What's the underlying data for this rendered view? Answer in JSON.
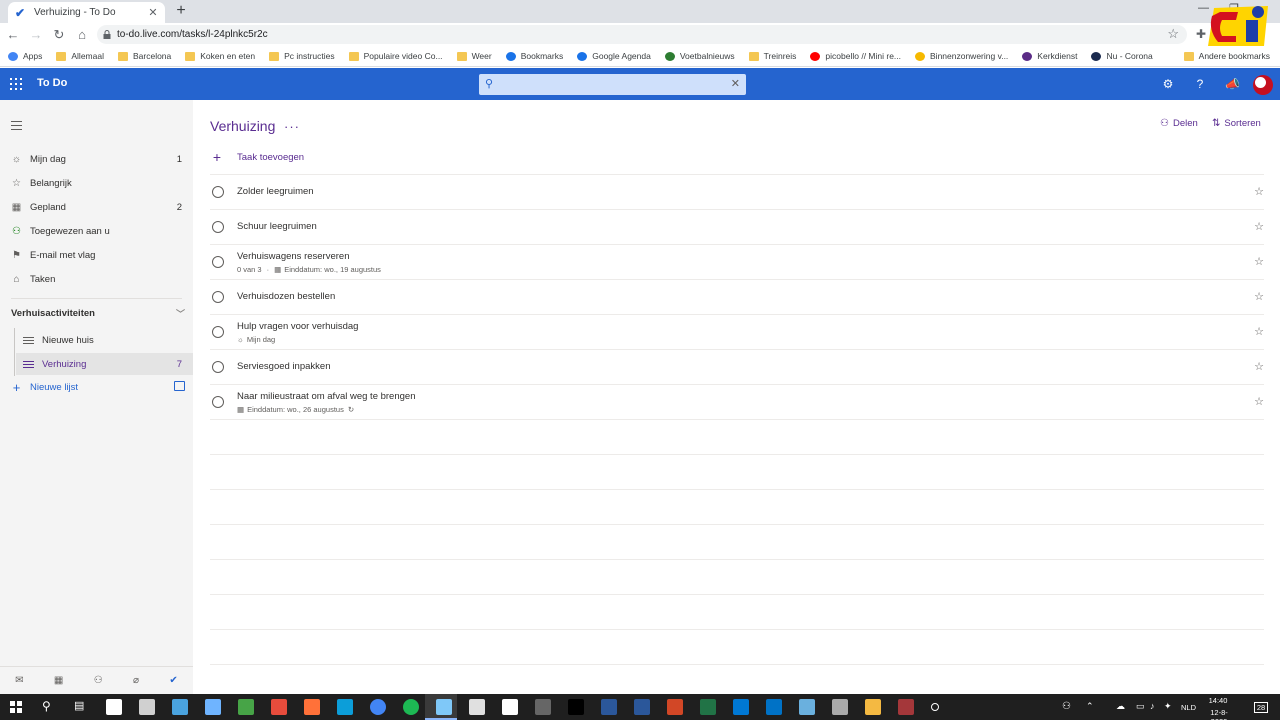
{
  "browser": {
    "tab_title": "Verhuizing - To Do",
    "tab_close": "✕",
    "new_tab": "+",
    "url": "to-do.live.com/tasks/l-24plnkc5r2c",
    "bookmarks": [
      {
        "label": "Apps",
        "icon": "apps-grid-icon",
        "color": "#4285f4"
      },
      {
        "label": "Allemaal",
        "icon": "folder-icon",
        "color": "#f4c753"
      },
      {
        "label": "Barcelona",
        "icon": "folder-icon",
        "color": "#f4c753"
      },
      {
        "label": "Koken en eten",
        "icon": "folder-icon",
        "color": "#f4c753"
      },
      {
        "label": "Pc instructies",
        "icon": "folder-icon",
        "color": "#f4c753"
      },
      {
        "label": "Populaire video Co...",
        "icon": "folder-icon",
        "color": "#f4c753"
      },
      {
        "label": "Weer",
        "icon": "folder-icon",
        "color": "#f4c753"
      },
      {
        "label": "Bookmarks",
        "icon": "star-icon",
        "color": "#1a73e8"
      },
      {
        "label": "Google Agenda",
        "icon": "calendar-icon",
        "color": "#1a73e8"
      },
      {
        "label": "Voetbalnieuws",
        "icon": "ball-icon",
        "color": "#2e7d32"
      },
      {
        "label": "Treinreis",
        "icon": "folder-icon",
        "color": "#f4c753"
      },
      {
        "label": "picobello // Mini re...",
        "icon": "youtube-icon",
        "color": "#ff0000"
      },
      {
        "label": "Binnenzonwering v...",
        "icon": "sun-icon",
        "color": "#f6b900"
      },
      {
        "label": "Kerkdienst",
        "icon": "church-icon",
        "color": "#5b2c86"
      },
      {
        "label": "Nu - Corona",
        "icon": "news-icon",
        "color": "#1b2a4e"
      }
    ],
    "other_bookmarks": "Andere bookmarks"
  },
  "app": {
    "name": "To Do",
    "search_placeholder": "",
    "accent": "#2564cf",
    "list_color": "#5a2d91"
  },
  "sidebar": {
    "items": [
      {
        "label": "Mijn dag",
        "count": "1",
        "icon": "sun-icon"
      },
      {
        "label": "Belangrijk",
        "count": "",
        "icon": "star-icon"
      },
      {
        "label": "Gepland",
        "count": "2",
        "icon": "calendar-icon"
      },
      {
        "label": "Toegewezen aan u",
        "count": "",
        "icon": "person-icon"
      },
      {
        "label": "E-mail met vlag",
        "count": "",
        "icon": "flag-icon"
      },
      {
        "label": "Taken",
        "count": "",
        "icon": "home-icon"
      }
    ],
    "group": {
      "label": "Verhuisactiviteiten",
      "lists": [
        {
          "label": "Nieuwe huis",
          "count": "",
          "active": false
        },
        {
          "label": "Verhuizing",
          "count": "7",
          "active": true
        }
      ]
    },
    "new_list_label": "Nieuwe lijst"
  },
  "main": {
    "title": "Verhuizing",
    "more": "···",
    "share_label": "Delen",
    "sort_label": "Sorteren",
    "add_task_label": "Taak toevoegen",
    "tasks": [
      {
        "title": "Zolder leegruimen",
        "meta": []
      },
      {
        "title": "Schuur leegruimen",
        "meta": []
      },
      {
        "title": "Verhuiswagens reserveren",
        "meta": [
          "0 van 3",
          "Einddatum: wo., 19 augustus"
        ]
      },
      {
        "title": "Verhuisdozen bestellen",
        "meta": []
      },
      {
        "title": "Hulp vragen voor verhuisdag",
        "meta": [
          "Mijn dag"
        ]
      },
      {
        "title": "Serviesgoed inpakken",
        "meta": []
      },
      {
        "title": "Naar milieustraat om afval weg te brengen",
        "meta": [
          "Einddatum: wo., 26 augustus"
        ]
      }
    ]
  },
  "taskbar": {
    "language": "NLD",
    "time": "14:40",
    "date": "12-8-2020",
    "notif_count": "28"
  }
}
